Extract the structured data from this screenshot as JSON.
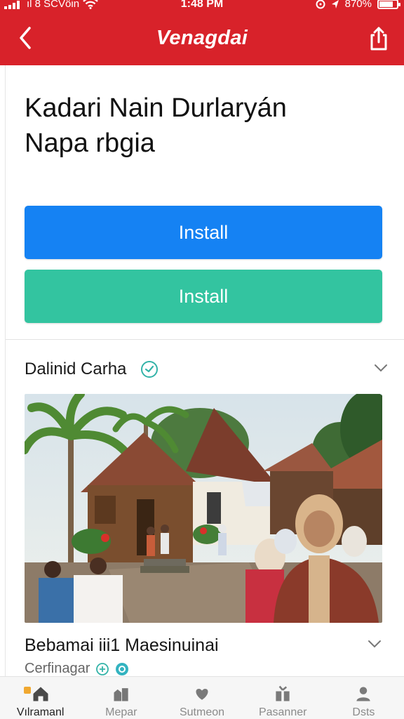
{
  "status_bar": {
    "carrier": "ıl 8 SCVöin",
    "time": "1:48 PM",
    "battery_percent": "870%",
    "battery_level": 0.8,
    "icons": [
      "signal-icon",
      "wifi-icon",
      "alarm-icon",
      "location-icon",
      "battery-icon"
    ]
  },
  "header": {
    "title": "Venagdai",
    "back_icon": "back-chevron-icon",
    "share_icon": "share-icon"
  },
  "app": {
    "title": "Kadari Nain Durlaryán Napa rbgia"
  },
  "buttons": {
    "primary_label": "Install",
    "secondary_label": "Install"
  },
  "section": {
    "title": "Dalinid Carha",
    "icon": "verified-badge-icon",
    "expand_icon": "chevron-down-icon"
  },
  "gallery": {
    "image_icon": "village-photo"
  },
  "caption": {
    "title": "Bebamai iii1 Maesinuinai",
    "subtitle": "Cerfinagar",
    "expand_icon": "chevron-down-icon"
  },
  "bottom_nav": [
    {
      "label": "Vılramanl",
      "icon": "home-icon",
      "active": true
    },
    {
      "label": "Mepar",
      "icon": "buildings-icon",
      "active": false
    },
    {
      "label": "Sutmeon",
      "icon": "heart-hand-icon",
      "active": false
    },
    {
      "label": "Pasanner",
      "icon": "gift-icon",
      "active": false
    },
    {
      "label": "Dsts",
      "icon": "profile-icon",
      "active": false
    }
  ],
  "colors": {
    "header_red": "#d8222a",
    "primary_blue": "#1582f3",
    "secondary_teal": "#33c4a0"
  }
}
